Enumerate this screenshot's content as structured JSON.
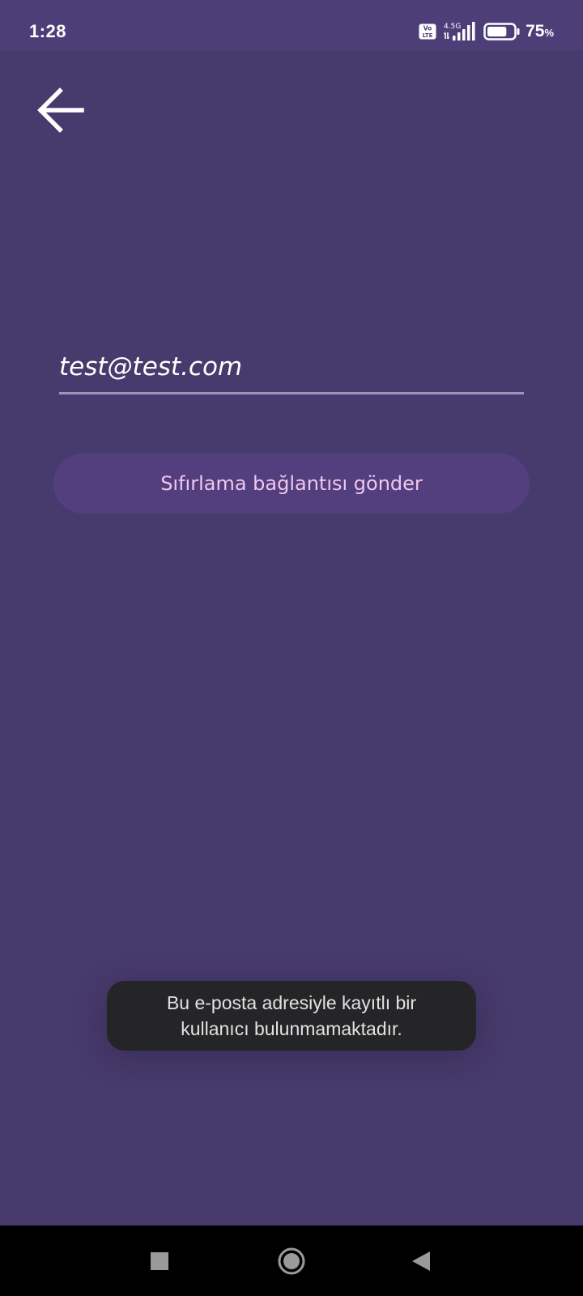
{
  "status_bar": {
    "time": "1:28",
    "network_type": "4.5G",
    "volte": "Vo LTE",
    "battery_percent": "75",
    "battery_unit": "%",
    "battery_level": 0.75
  },
  "form": {
    "email_value": "test@test.com",
    "send_button_label": "Sıfırlama bağlantısı gönder"
  },
  "toast": {
    "message": "Bu e-posta adresiyle kayıtlı bir kullanıcı bulunmamaktadır."
  },
  "navigation": {
    "recents": "square-icon",
    "home": "circle-icon",
    "back": "triangle-back-icon"
  },
  "colors": {
    "background": "#473a6c",
    "status_bar": "#4d3e78",
    "button_bg": "#533f7e",
    "button_text": "#f0c8ee",
    "toast_bg": "#252427"
  }
}
